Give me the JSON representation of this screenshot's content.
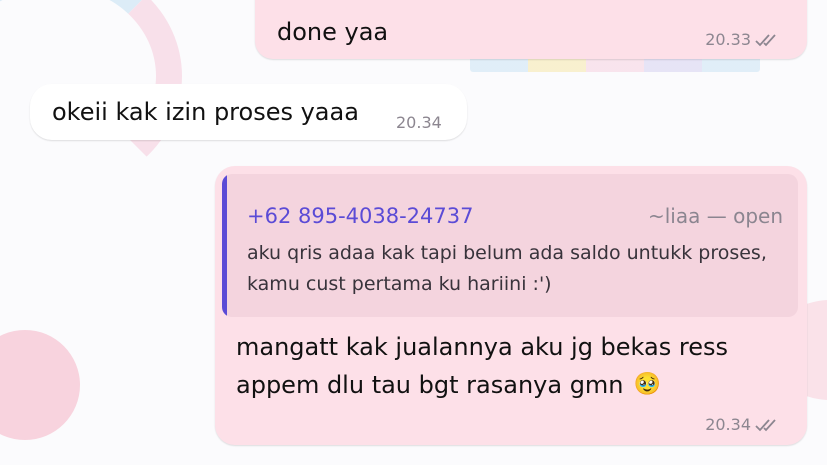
{
  "messages": [
    {
      "direction": "outgoing",
      "text": "done yaa",
      "time": "20.33",
      "status": "read"
    },
    {
      "direction": "incoming",
      "text": "okeii kak izin proses yaaa",
      "time": "20.34"
    },
    {
      "direction": "outgoing",
      "quote": {
        "sender": "+62 895-4038-24737",
        "push_name": "~liaa — open",
        "text": "aku qris adaa kak tapi belum ada saldo untukk proses, kamu cust pertama ku hariini :')"
      },
      "line1": "mangatt kak jualannya aku jg bekas ress",
      "line2": "appem dlu tau bgt rasanya gmn",
      "emoji": "🥹",
      "time": "20.34",
      "status": "read"
    }
  ],
  "colors": {
    "outgoing_bubble": "#fde0e8",
    "incoming_bubble": "#ffffff",
    "quote_accent": "#5b4bd6"
  },
  "icons": {
    "read_receipt": "double-check-icon"
  }
}
